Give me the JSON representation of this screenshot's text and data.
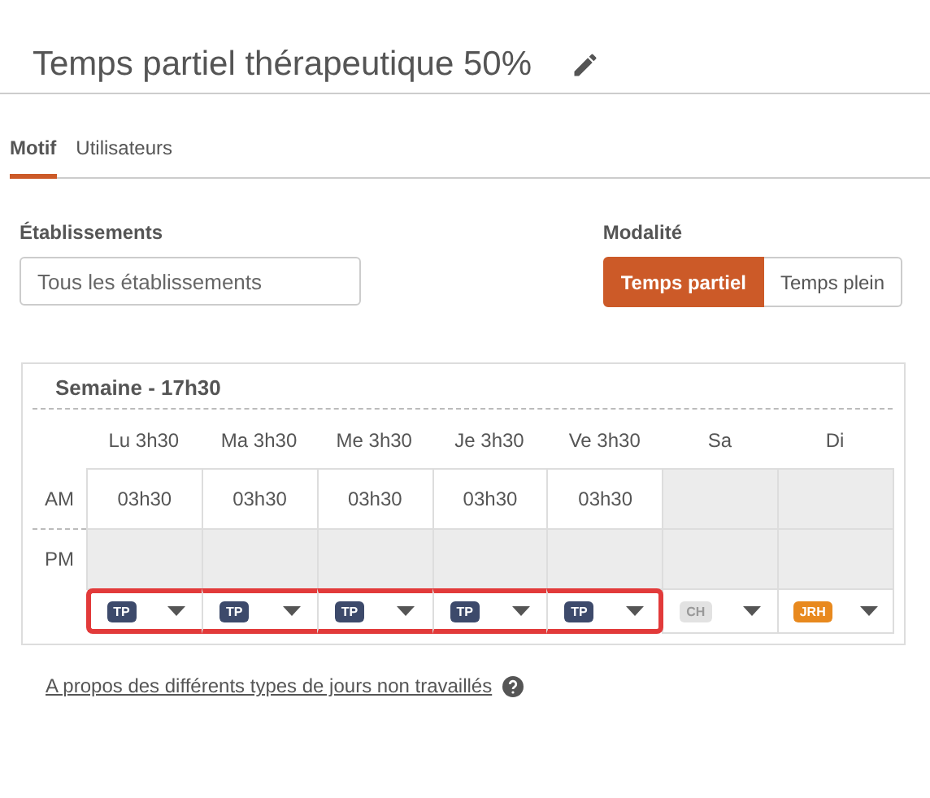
{
  "title": "Temps partiel thérapeutique 50%",
  "tabs": [
    {
      "label": "Motif",
      "selected": true
    },
    {
      "label": "Utilisateurs",
      "selected": false
    }
  ],
  "establishments": {
    "label": "Établissements",
    "placeholder": "Tous les établissements"
  },
  "modality": {
    "label": "Modalité",
    "options": [
      {
        "label": "Temps partiel",
        "selected": true
      },
      {
        "label": "Temps plein",
        "selected": false
      }
    ]
  },
  "week": {
    "title": "Semaine - 17h30",
    "row_labels": [
      "AM",
      "PM"
    ],
    "days": [
      {
        "label": "Lu 3h30",
        "am_worked": true,
        "am_hours": "03h30",
        "pm_worked": false,
        "tag": "TP",
        "color": "#3d4a6b",
        "highlighted": true
      },
      {
        "label": "Ma 3h30",
        "am_worked": true,
        "am_hours": "03h30",
        "pm_worked": false,
        "tag": "TP",
        "color": "#3d4a6b",
        "highlighted": true
      },
      {
        "label": "Me 3h30",
        "am_worked": true,
        "am_hours": "03h30",
        "pm_worked": false,
        "tag": "TP",
        "color": "#3d4a6b",
        "highlighted": true
      },
      {
        "label": "Je 3h30",
        "am_worked": true,
        "am_hours": "03h30",
        "pm_worked": false,
        "tag": "TP",
        "color": "#3d4a6b",
        "highlighted": true
      },
      {
        "label": "Ve 3h30",
        "am_worked": true,
        "am_hours": "03h30",
        "pm_worked": false,
        "tag": "TP",
        "color": "#3d4a6b",
        "highlighted": true
      },
      {
        "label": "Sa",
        "am_worked": false,
        "pm_worked": false,
        "tag": "CH",
        "color": "#e2e2e2",
        "highlighted": false
      },
      {
        "label": "Di",
        "am_worked": false,
        "pm_worked": false,
        "tag": "JRH",
        "color": "#e8891e",
        "highlighted": false
      }
    ]
  },
  "help_link": "A propos des différents types de jours non travaillés"
}
